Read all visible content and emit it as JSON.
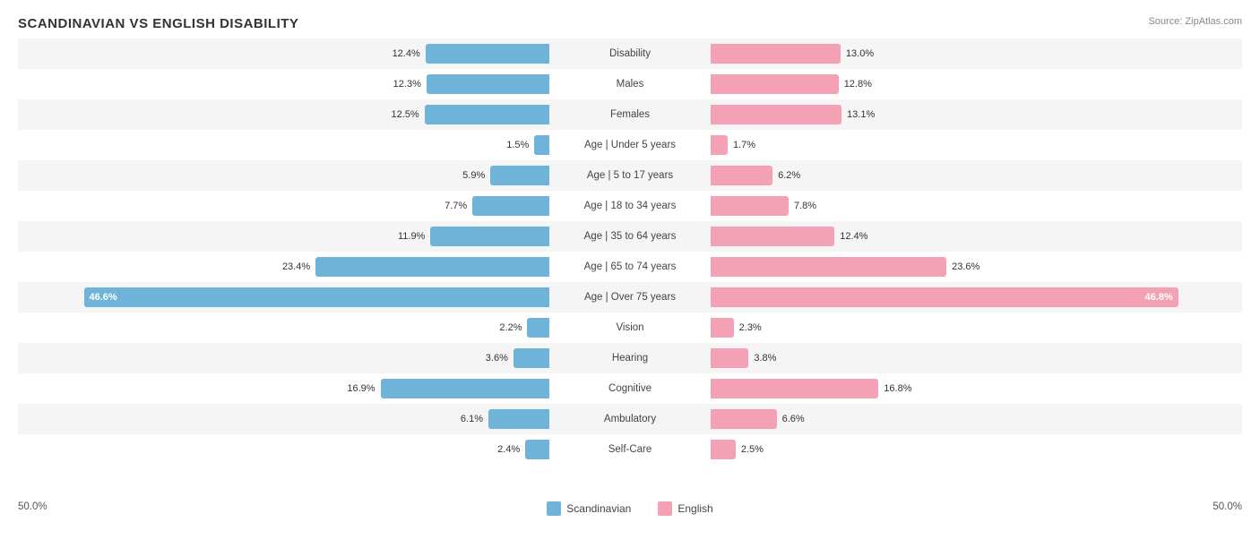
{
  "title": "SCANDINAVIAN VS ENGLISH DISABILITY",
  "source": "Source: ZipAtlas.com",
  "legend": {
    "scandinavian_label": "Scandinavian",
    "english_label": "English",
    "scandinavian_color": "#6fb3d9",
    "english_color": "#f4a0b5"
  },
  "axis": {
    "left": "50.0%",
    "right": "50.0%"
  },
  "rows": [
    {
      "label": "Disability",
      "left_val": "12.4%",
      "right_val": "13.0%",
      "left_pct": 24.8,
      "right_pct": 26.0
    },
    {
      "label": "Males",
      "left_val": "12.3%",
      "right_val": "12.8%",
      "left_pct": 24.6,
      "right_pct": 25.6
    },
    {
      "label": "Females",
      "left_val": "12.5%",
      "right_val": "13.1%",
      "left_pct": 25.0,
      "right_pct": 26.2
    },
    {
      "label": "Age | Under 5 years",
      "left_val": "1.5%",
      "right_val": "1.7%",
      "left_pct": 3.0,
      "right_pct": 3.4
    },
    {
      "label": "Age | 5 to 17 years",
      "left_val": "5.9%",
      "right_val": "6.2%",
      "left_pct": 11.8,
      "right_pct": 12.4
    },
    {
      "label": "Age | 18 to 34 years",
      "left_val": "7.7%",
      "right_val": "7.8%",
      "left_pct": 15.4,
      "right_pct": 15.6
    },
    {
      "label": "Age | 35 to 64 years",
      "left_val": "11.9%",
      "right_val": "12.4%",
      "left_pct": 23.8,
      "right_pct": 24.8
    },
    {
      "label": "Age | 65 to 74 years",
      "left_val": "23.4%",
      "right_val": "23.6%",
      "left_pct": 46.8,
      "right_pct": 47.2
    },
    {
      "label": "Age | Over 75 years",
      "left_val": "46.6%",
      "right_val": "46.8%",
      "left_pct": 93.2,
      "right_pct": 93.6,
      "wide": true
    },
    {
      "label": "Vision",
      "left_val": "2.2%",
      "right_val": "2.3%",
      "left_pct": 4.4,
      "right_pct": 4.6
    },
    {
      "label": "Hearing",
      "left_val": "3.6%",
      "right_val": "3.8%",
      "left_pct": 7.2,
      "right_pct": 7.6
    },
    {
      "label": "Cognitive",
      "left_val": "16.9%",
      "right_val": "16.8%",
      "left_pct": 33.8,
      "right_pct": 33.6
    },
    {
      "label": "Ambulatory",
      "left_val": "6.1%",
      "right_val": "6.6%",
      "left_pct": 12.2,
      "right_pct": 13.2
    },
    {
      "label": "Self-Care",
      "left_val": "2.4%",
      "right_val": "2.5%",
      "left_pct": 4.8,
      "right_pct": 5.0
    }
  ]
}
